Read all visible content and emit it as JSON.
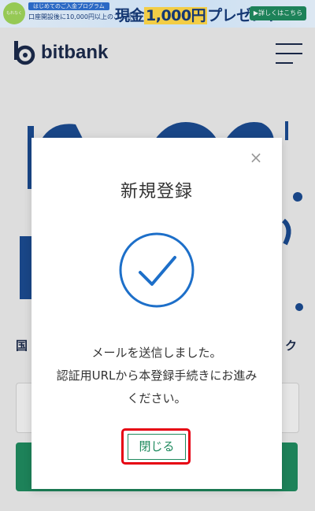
{
  "banner": {
    "badge": "もれなく",
    "line1": "はじめてのご入金プログラム",
    "line2": "口座開設後に10,000円以上のご入金で",
    "prize_prefix": "現金",
    "prize_amount": "1,000円",
    "prize_suffix": "プレゼント!",
    "detail_button": "▶詳しくはこちら"
  },
  "header": {
    "brand": "bitbank",
    "menu_icon": "hamburger-icon"
  },
  "background": {
    "hero_sub": "国",
    "hero_sub_right": "ク"
  },
  "modal": {
    "close_icon": "×",
    "title": "新規登録",
    "message_line1": "メールを送信しました。",
    "message_line2": "認証用URLから本登録手続きにお進み",
    "message_line3": "ください。",
    "close_button": "閉じる"
  },
  "colors": {
    "accent_green": "#1f8a5e",
    "check_blue": "#1d6fc9",
    "highlight_red": "#e60012",
    "brand_navy": "#1b2a4a"
  }
}
